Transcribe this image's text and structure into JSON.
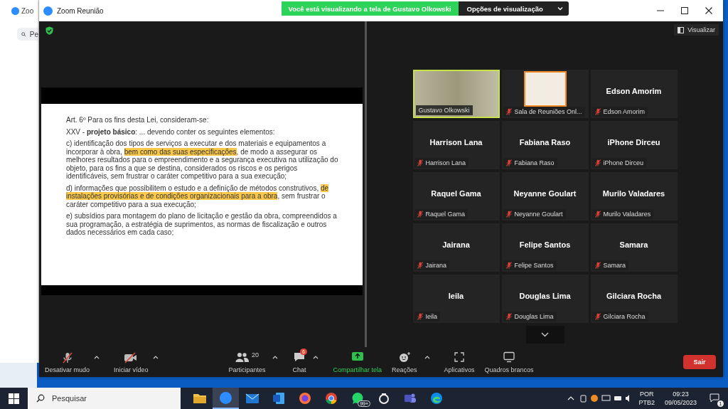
{
  "background_window": {
    "title": "Zoo",
    "search_text": "Pe"
  },
  "window": {
    "title": "Zoom Reunião"
  },
  "share_banner": {
    "message": "Você está visualizando a tela de Gustavo Olkowski",
    "options_button": "Opções de visualização"
  },
  "view_button": "Visualizar",
  "slide": {
    "paragraphs": [
      [
        {
          "text": "Art. 6º Para os fins desta Lei, consideram-se:",
          "highlighted": false
        }
      ],
      [
        {
          "text": "XXV - **projeto básico**: ... devendo conter os seguintes elementos:",
          "highlighted": false
        }
      ],
      [
        {
          "text": "c) identificação dos tipos de serviços a executar e dos materiais e equipamentos a incorporar à obra, ",
          "highlighted": false
        },
        {
          "text": "bem como das suas especificações",
          "highlighted": true
        },
        {
          "text": ", de modo a assegurar os melhores resultados para o empreendimento e a segurança executiva na utilização do objeto, para os fins a que se destina, considerados os riscos e os perigos identificáveis, sem frustrar o caráter competitivo para a sua execução;",
          "highlighted": false
        }
      ],
      [
        {
          "text": "d) informações que possibilitem o estudo e a definição de métodos construtivos, ",
          "highlighted": false
        },
        {
          "text": "de instalações provisórias e de condições organizacionais para a obra",
          "highlighted": true
        },
        {
          "text": ", sem frustrar o caráter competitivo para a sua execução;",
          "highlighted": false
        }
      ],
      [
        {
          "text": "e) subsídios para montagem do plano de licitação e gestão da obra, compreendidos a sua programação, a estratégia de suprimentos, as normas de fiscalização e outros dados necessários em cada caso;",
          "highlighted": false
        }
      ]
    ]
  },
  "participants": [
    {
      "kind": "video",
      "label": "Gustavo Olkowski",
      "muted": false,
      "speaking": true
    },
    {
      "kind": "image",
      "label": "Sala de Reuniões Onl...",
      "muted": true,
      "speaking": false
    },
    {
      "kind": "name",
      "name": "Edson Amorim",
      "label": "Edson Amorim",
      "muted": true,
      "speaking": false
    },
    {
      "kind": "name",
      "name": "Harrison Lana",
      "label": "Harrison Lana",
      "muted": true,
      "speaking": false
    },
    {
      "kind": "name",
      "name": "Fabiana Raso",
      "label": "Fabiana Raso",
      "muted": true,
      "speaking": false
    },
    {
      "kind": "name",
      "name": "iPhone Dirceu",
      "label": "iPhone Dirceu",
      "muted": true,
      "speaking": false
    },
    {
      "kind": "name",
      "name": "Raquel Gama",
      "label": "Raquel Gama",
      "muted": true,
      "speaking": false
    },
    {
      "kind": "name",
      "name": "Neyanne Goulart",
      "label": "Neyanne Goulart",
      "muted": true,
      "speaking": false
    },
    {
      "kind": "name",
      "name": "Murilo Valadares",
      "label": "Murilo Valadares",
      "muted": true,
      "speaking": false
    },
    {
      "kind": "name",
      "name": "Jairana",
      "label": "Jairana",
      "muted": true,
      "speaking": false
    },
    {
      "kind": "name",
      "name": "Felipe Santos",
      "label": "Felipe Santos",
      "muted": true,
      "speaking": false
    },
    {
      "kind": "name",
      "name": "Samara",
      "label": "Samara",
      "muted": true,
      "speaking": false
    },
    {
      "kind": "name",
      "name": "Ieila",
      "label": "Ieila",
      "muted": true,
      "speaking": false
    },
    {
      "kind": "name",
      "name": "Douglas Lima",
      "label": "Douglas Lima",
      "muted": true,
      "speaking": false
    },
    {
      "kind": "name",
      "name": "Gilciara Rocha",
      "label": "Gilciara Rocha",
      "muted": true,
      "speaking": false
    }
  ],
  "toolbar": {
    "left": [
      {
        "kind": "mic-muted",
        "label": "Desativar mudo",
        "has_menu": true
      },
      {
        "kind": "video-off",
        "label": "Iniciar vídeo",
        "has_menu": true
      }
    ],
    "center": [
      {
        "kind": "people",
        "label": "Participantes",
        "count": "20",
        "has_menu": true
      },
      {
        "kind": "chat",
        "label": "Chat",
        "badge": "6",
        "has_menu": true
      },
      {
        "kind": "share",
        "label": "Compartilhar tela",
        "has_menu": false
      },
      {
        "kind": "reactions",
        "label": "Reações",
        "has_menu": true
      },
      {
        "kind": "apps",
        "label": "Aplicativos",
        "has_menu": false
      },
      {
        "kind": "whiteboard",
        "label": "Quadros brancos",
        "has_menu": false
      }
    ],
    "leave_button": "Sair"
  },
  "taskbar": {
    "search_placeholder": "Pesquisar",
    "apps": [
      {
        "kind": "folder",
        "selected": false
      },
      {
        "kind": "zoom",
        "selected": true
      },
      {
        "kind": "mail",
        "selected": false
      },
      {
        "kind": "word",
        "selected": false
      },
      {
        "kind": "firefox",
        "selected": false
      },
      {
        "kind": "chrome",
        "selected": false
      },
      {
        "kind": "whatsapp",
        "selected": false,
        "badge": "99+"
      },
      {
        "kind": "ring",
        "selected": false
      },
      {
        "kind": "teams",
        "selected": false
      },
      {
        "kind": "edge",
        "selected": false
      }
    ],
    "language": "POR",
    "keyboard": "PTB2",
    "time": "09:23",
    "date": "09/05/2023",
    "notifications": "1"
  }
}
